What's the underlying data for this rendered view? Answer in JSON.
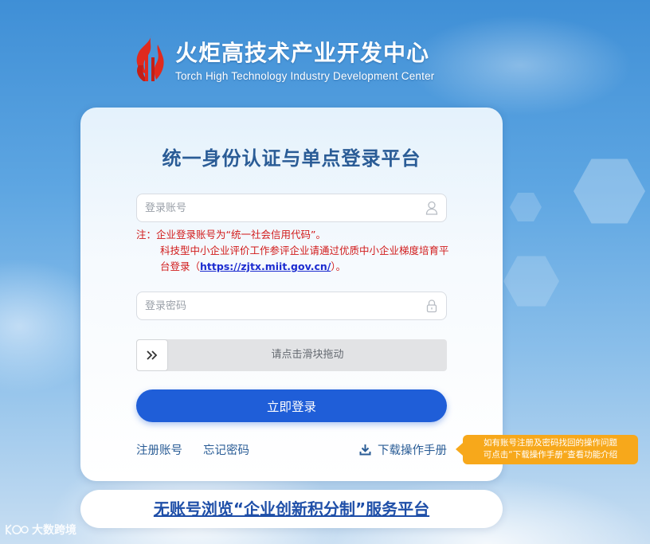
{
  "brand": {
    "name_cn": "火炬高技术产业开发中心",
    "name_en": "Torch High Technology Industry Development Center"
  },
  "card": {
    "title": "统一身份认证与单点登录平台"
  },
  "account_field": {
    "placeholder": "登录账号",
    "value": "",
    "icon": "user-icon"
  },
  "note": {
    "line1": "注：企业登录账号为“统一社会信用代码”。",
    "line2_prefix": "科技型中小企业评价工作参评企业请通过优质中小企业梯度培育平台登录（",
    "line2_link": "https://zjtx.miit.gov.cn/",
    "line2_suffix": "）。"
  },
  "password_field": {
    "placeholder": "登录密码",
    "value": "",
    "icon": "lock-icon"
  },
  "slider": {
    "hint": "请点击滑块拖动",
    "icon": "double-chevron-right-icon"
  },
  "login_button": {
    "label": "立即登录"
  },
  "links": {
    "register": "注册账号",
    "forgot": "忘记密码",
    "download": "下载操作手册",
    "download_icon": "download-icon"
  },
  "tooltip": {
    "line1": "如有账号注册及密码找回的操作问题",
    "line2": "可点击“下载操作手册”查看功能介绍"
  },
  "bottom_link": {
    "label": "无账号浏览“企业创新积分制”服务平台"
  },
  "watermark": {
    "text": "大数跨境"
  },
  "colors": {
    "primary_button": "#1f5ed8",
    "title": "#2a5c96",
    "note_red": "#d11b1b",
    "tooltip_orange": "#f7a81b",
    "logo_red": "#e02a1e"
  }
}
